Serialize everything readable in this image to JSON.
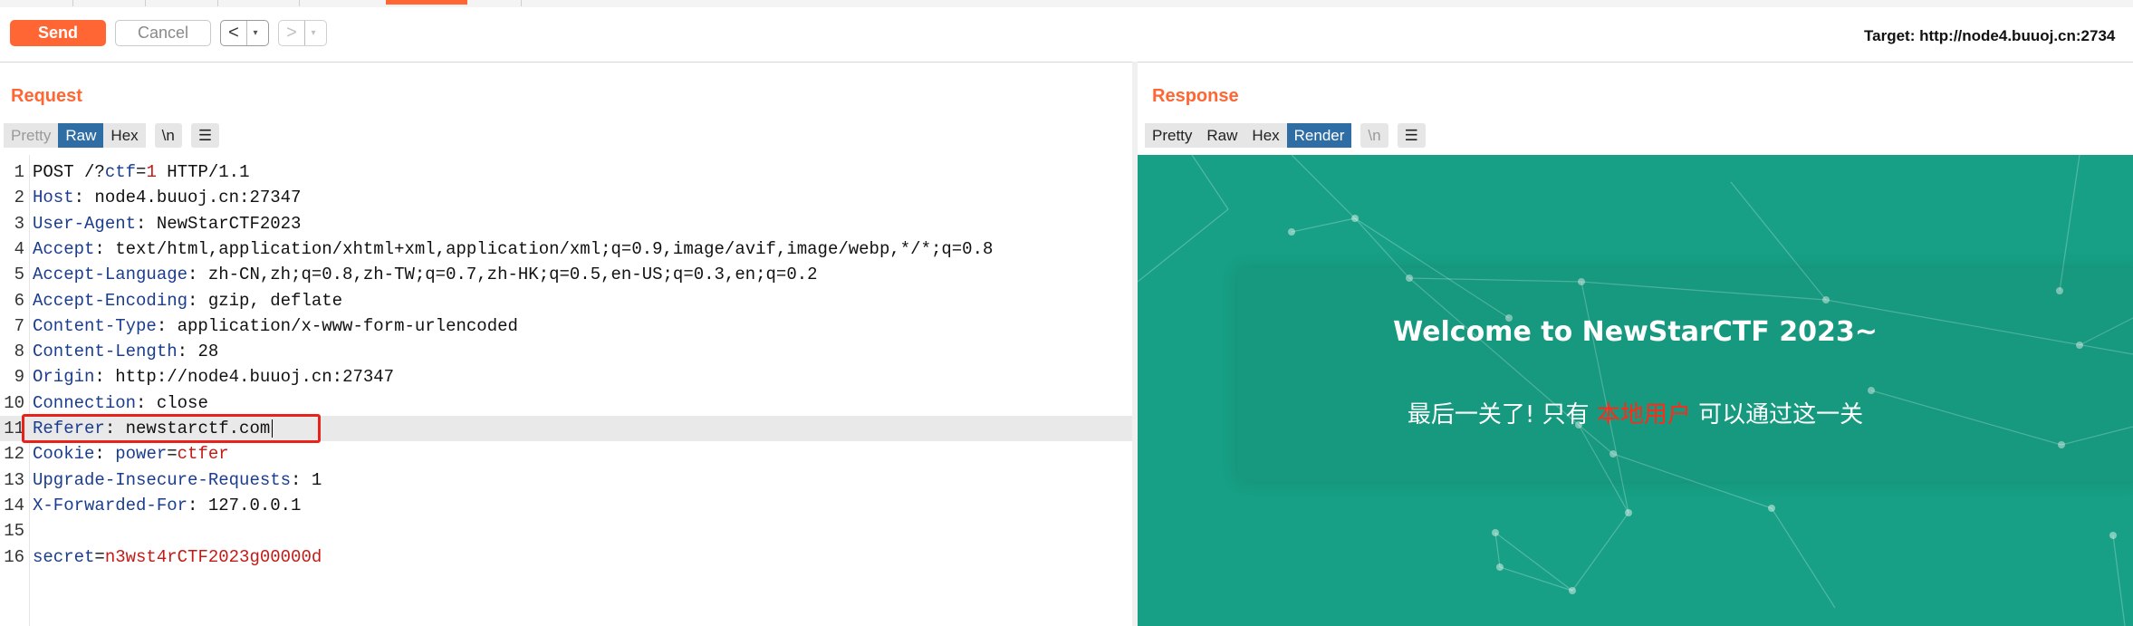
{
  "toolbar": {
    "send_label": "Send",
    "cancel_label": "Cancel",
    "back_arrow": "<",
    "forward_arrow": ">",
    "dropdown_glyph": "▾",
    "target": "Target: http://node4.buuoj.cn:2734"
  },
  "request": {
    "title": "Request",
    "tabs": [
      {
        "label": "Pretty",
        "state": "disabled"
      },
      {
        "label": "Raw",
        "state": "active"
      },
      {
        "label": "Hex",
        "state": "normal"
      },
      {
        "label": "\\n",
        "state": "normal"
      },
      {
        "label": "☰",
        "state": "normal"
      }
    ],
    "lines": [
      {
        "n": "1",
        "parts": [
          [
            "v",
            "POST /?"
          ],
          [
            "p",
            "ctf"
          ],
          [
            "v",
            "="
          ],
          [
            "r",
            "1"
          ],
          [
            "v",
            " HTTP/1.1"
          ]
        ]
      },
      {
        "n": "2",
        "parts": [
          [
            "k",
            "Host"
          ],
          [
            "v",
            ": node4.buuoj.cn:27347"
          ]
        ]
      },
      {
        "n": "3",
        "parts": [
          [
            "k",
            "User-Agent"
          ],
          [
            "v",
            ": NewStarCTF2023"
          ]
        ]
      },
      {
        "n": "4",
        "parts": [
          [
            "k",
            "Accept"
          ],
          [
            "v",
            ": text/html,application/xhtml+xml,application/xml;q=0.9,image/avif,image/webp,*/*;q=0.8"
          ]
        ]
      },
      {
        "n": "5",
        "parts": [
          [
            "k",
            "Accept-Language"
          ],
          [
            "v",
            ": zh-CN,zh;q=0.8,zh-TW;q=0.7,zh-HK;q=0.5,en-US;q=0.3,en;q=0.2"
          ]
        ]
      },
      {
        "n": "6",
        "parts": [
          [
            "k",
            "Accept-Encoding"
          ],
          [
            "v",
            ": gzip, deflate"
          ]
        ]
      },
      {
        "n": "7",
        "parts": [
          [
            "k",
            "Content-Type"
          ],
          [
            "v",
            ": application/x-www-form-urlencoded"
          ]
        ]
      },
      {
        "n": "8",
        "parts": [
          [
            "k",
            "Content-Length"
          ],
          [
            "v",
            ": 28"
          ]
        ]
      },
      {
        "n": "9",
        "parts": [
          [
            "k",
            "Origin"
          ],
          [
            "v",
            ": http://node4.buuoj.cn:27347"
          ]
        ]
      },
      {
        "n": "10",
        "parts": [
          [
            "k",
            "Connection"
          ],
          [
            "v",
            ": close"
          ]
        ]
      },
      {
        "n": "11",
        "parts": [
          [
            "k",
            "Referer"
          ],
          [
            "v",
            ": newstarctf.com"
          ]
        ],
        "highlight": true
      },
      {
        "n": "12",
        "parts": [
          [
            "k",
            "Cookie"
          ],
          [
            "v",
            ": "
          ],
          [
            "p",
            "power"
          ],
          [
            "v",
            "="
          ],
          [
            "r",
            "ctfer"
          ]
        ]
      },
      {
        "n": "13",
        "parts": [
          [
            "k",
            "Upgrade-Insecure-Requests"
          ],
          [
            "v",
            ": 1"
          ]
        ]
      },
      {
        "n": "14",
        "parts": [
          [
            "k",
            "X-Forwarded-For"
          ],
          [
            "v",
            ": 127.0.0.1"
          ]
        ]
      },
      {
        "n": "15",
        "parts": []
      },
      {
        "n": "16",
        "parts": [
          [
            "p",
            "secret"
          ],
          [
            "v",
            "="
          ],
          [
            "r",
            "n3wst4rCTF2023g00000d"
          ]
        ]
      }
    ]
  },
  "response": {
    "title": "Response",
    "tabs": [
      {
        "label": "Pretty",
        "state": "normal"
      },
      {
        "label": "Raw",
        "state": "normal"
      },
      {
        "label": "Hex",
        "state": "normal"
      },
      {
        "label": "Render",
        "state": "active"
      },
      {
        "label": "\\n",
        "state": "disabled"
      },
      {
        "label": "☰",
        "state": "normal"
      }
    ],
    "render": {
      "heading": "Welcome to NewStarCTF 2023~",
      "message_before": "最后一关了! 只有 ",
      "message_highlight": "本地用户",
      "message_after": " 可以通过这一关",
      "background_color": "#17a085",
      "highlight_color": "#ff2a1a"
    }
  },
  "colors": {
    "accent": "#ff6633",
    "active_tab": "#2f6ea5",
    "header_key": "#1b3d8f",
    "param_value": "#c41a16",
    "annotation_box": "#e8211a"
  }
}
